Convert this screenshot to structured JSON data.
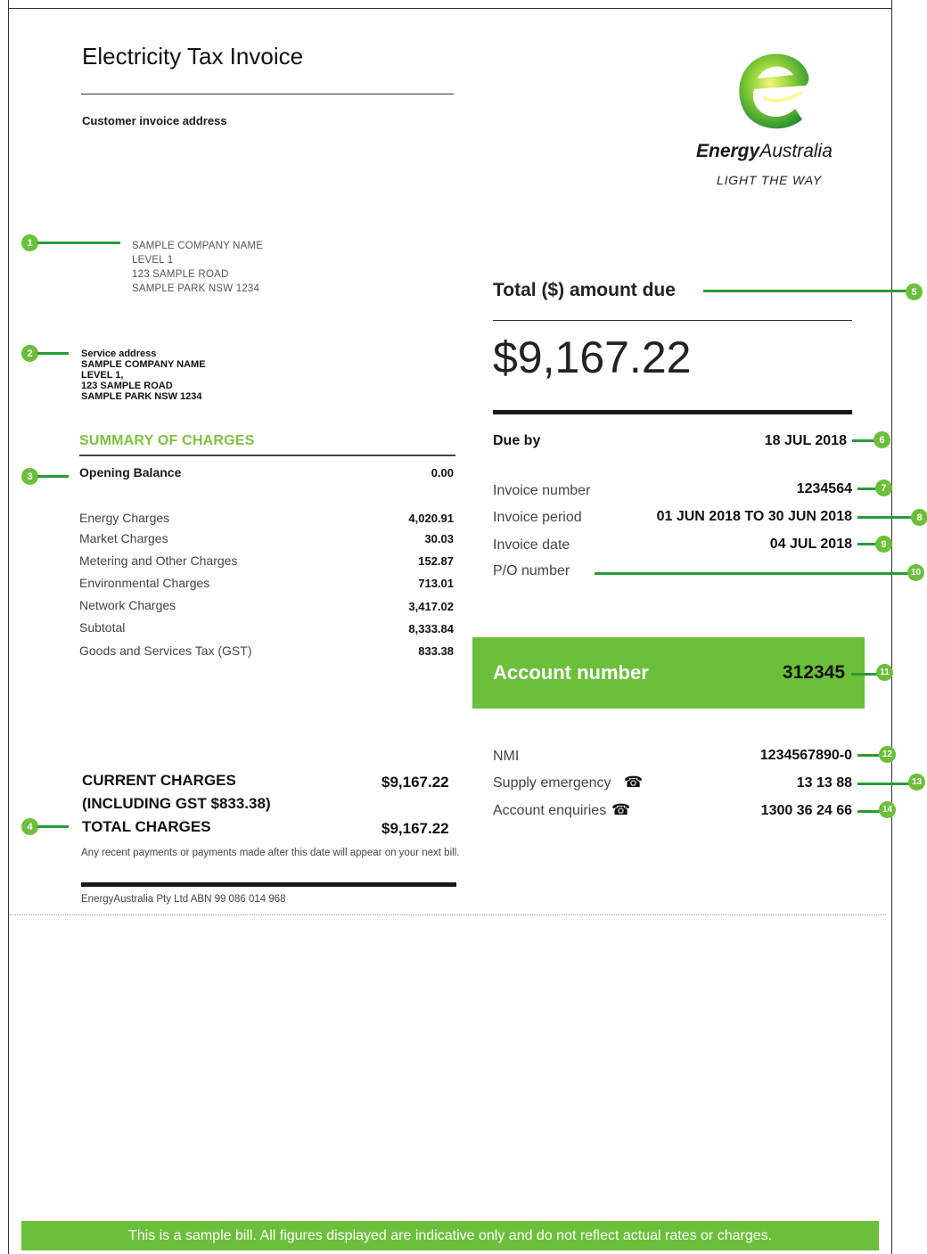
{
  "header": {
    "title": "Electricity Tax Invoice",
    "customer_invoice_address_label": "Customer invoice address"
  },
  "logo": {
    "brand_bold": "Energy",
    "brand_italic": "Australia",
    "tagline": "LIGHT THE WAY",
    "colors": {
      "primary": "#6cbf3a",
      "dark": "#1f8c2e",
      "light": "#d8ec3a"
    }
  },
  "customer_address": {
    "lines": [
      "SAMPLE COMPANY NAME",
      "LEVEL 1",
      "123 SAMPLE ROAD",
      "SAMPLE PARK NSW 1234"
    ]
  },
  "service_address": {
    "label": "Service address",
    "lines": [
      "SAMPLE COMPANY NAME",
      "LEVEL 1,",
      "123 SAMPLE ROAD",
      "SAMPLE PARK NSW 1234"
    ]
  },
  "summary": {
    "heading": "SUMMARY OF CHARGES",
    "opening_balance": {
      "label": "Opening Balance",
      "value": "0.00"
    },
    "rows": [
      {
        "label": "Energy Charges",
        "value": "4,020.91"
      },
      {
        "label": "Market Charges",
        "value": "30.03"
      },
      {
        "label": "Metering and Other Charges",
        "value": "152.87"
      },
      {
        "label": "Environmental Charges",
        "value": "713.01"
      },
      {
        "label": "Network Charges",
        "value": "3,417.02"
      },
      {
        "label": "Subtotal",
        "value": "8,333.84"
      },
      {
        "label": "Goods and Services Tax (GST)",
        "value": "833.38"
      }
    ],
    "current_charges_label": "CURRENT CHARGES",
    "current_charges_gst": "(INCLUDING GST $833.38)",
    "current_charges_value": "$9,167.22",
    "total_charges_label": "TOTAL CHARGES",
    "total_charges_value": "$9,167.22",
    "note": "Any recent payments or payments made after this date will appear on your next bill.",
    "abn": "EnergyAustralia Pty Ltd ABN 99 086 014 968"
  },
  "amount": {
    "label": "Total ($) amount due",
    "value": "$9,167.22"
  },
  "details": {
    "due_by_label": "Due by",
    "due_by_value": "18 JUL 2018",
    "invoice_number_label": "Invoice number",
    "invoice_number_value": "1234564",
    "invoice_period_label": "Invoice period",
    "invoice_period_value": "01 JUN 2018 TO 30 JUN 2018",
    "invoice_date_label": "Invoice date",
    "invoice_date_value": "04 JUL 2018",
    "po_number_label": "P/O number"
  },
  "account": {
    "label": "Account number",
    "value": "312345"
  },
  "contacts": {
    "nmi_label": "NMI",
    "nmi_value": "1234567890-0",
    "supply_label": "Supply emergency",
    "supply_value": "13 13 88",
    "enquiries_label": "Account enquiries",
    "enquiries_value": "1300 36 24 66",
    "phone_icon": "☎"
  },
  "markers": [
    "1",
    "2",
    "3",
    "4",
    "5",
    "6",
    "7",
    "8",
    "9",
    "10",
    "11",
    "12",
    "13",
    "14"
  ],
  "banner": {
    "text": "This is a sample bill. All figures displayed are indicative only and do not reflect actual rates or charges."
  }
}
